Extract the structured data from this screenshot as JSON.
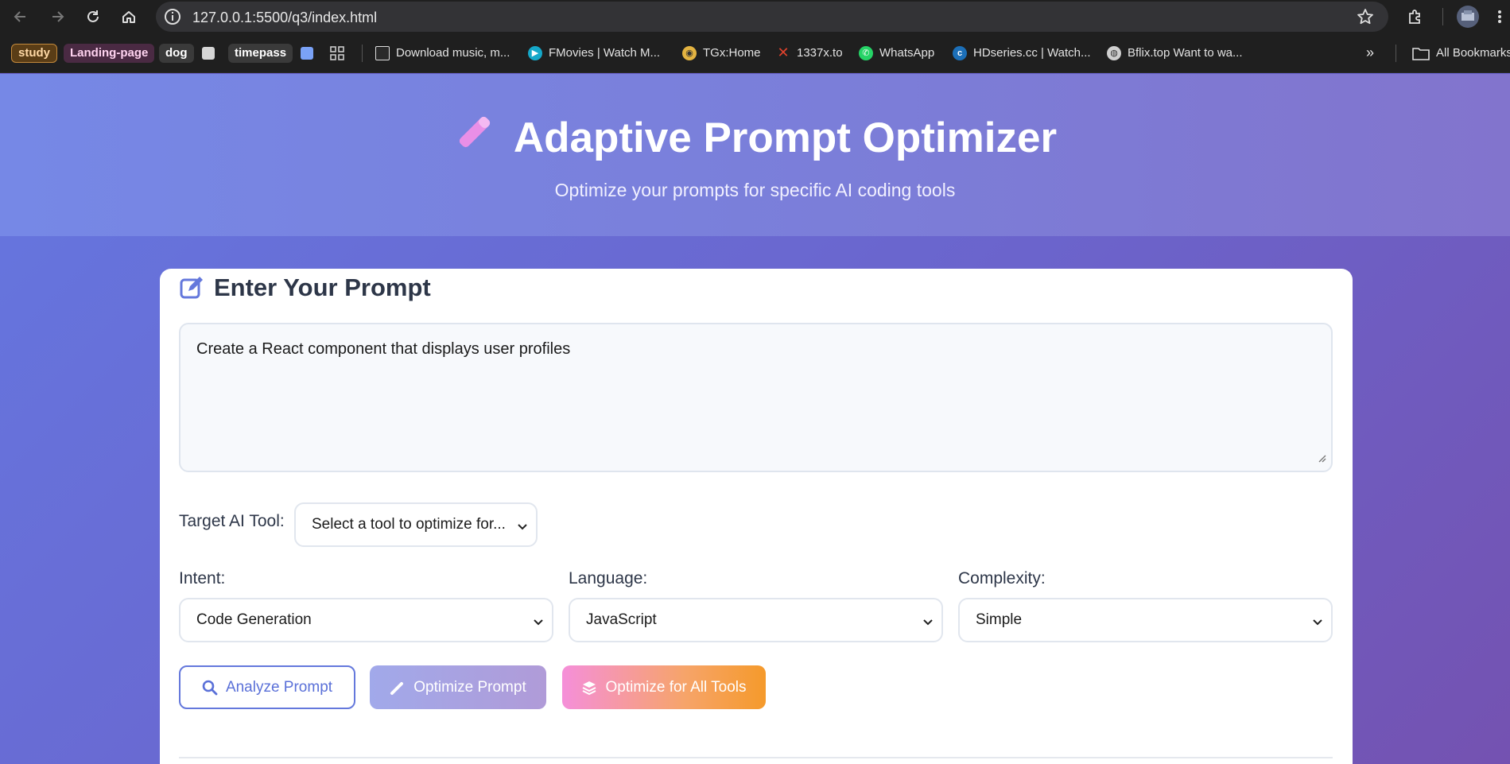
{
  "browser": {
    "url": "127.0.0.1:5500/q3/index.html",
    "bookmarks": [
      {
        "label": "study",
        "kind": "tag"
      },
      {
        "label": "Landing-page",
        "kind": "tag"
      },
      {
        "label": "dog",
        "kind": "tag"
      },
      {
        "label": "timepass",
        "kind": "tag"
      },
      {
        "label": "Download music, m...",
        "kind": "site"
      },
      {
        "label": "FMovies | Watch M...",
        "kind": "site"
      },
      {
        "label": "TGx:Home",
        "kind": "site"
      },
      {
        "label": "1337x.to",
        "kind": "site"
      },
      {
        "label": "WhatsApp",
        "kind": "site"
      },
      {
        "label": "HDseries.cc | Watch...",
        "kind": "site"
      },
      {
        "label": "Bflix.top Want to wa...",
        "kind": "site"
      }
    ],
    "all_bookmarks_label": "All Bookmarks"
  },
  "header": {
    "title": "Adaptive Prompt Optimizer",
    "subtitle": "Optimize your prompts for specific AI coding tools"
  },
  "prompt_card": {
    "title": "Enter Your Prompt",
    "prompt_value": "Create a React component that displays user profiles",
    "target_label": "Target AI Tool:",
    "target_value": "Select a tool to optimize for...",
    "intent_label": "Intent:",
    "intent_value": "Code Generation",
    "language_label": "Language:",
    "language_value": "JavaScript",
    "complexity_label": "Complexity:",
    "complexity_value": "Simple"
  },
  "actions": {
    "analyze": "Analyze Prompt",
    "optimize": "Optimize Prompt",
    "optimize_all": "Optimize for All Tools"
  },
  "colors": {
    "accent": "#6478dc",
    "title_text": "#2d3648"
  }
}
